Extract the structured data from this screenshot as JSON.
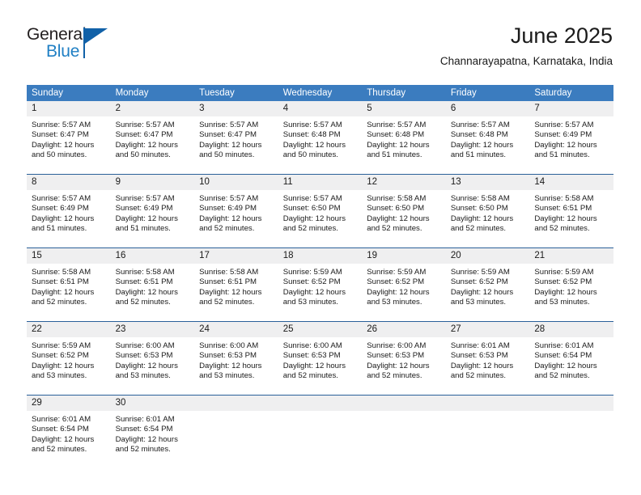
{
  "brand": {
    "name_part1": "General",
    "name_part2": "Blue",
    "logo_icon": "blue-triangle-flag-icon",
    "accent_color": "#1161a8",
    "blue_text_color": "#1f7fc4"
  },
  "header": {
    "title": "June 2025",
    "subtitle": "Channarayapatna, Karnataka, India"
  },
  "calendar": {
    "header_bg_color": "#3b7cbf",
    "daynum_bg_color": "#efeff0",
    "row_separator_color": "#2a6099",
    "weekdays": [
      "Sunday",
      "Monday",
      "Tuesday",
      "Wednesday",
      "Thursday",
      "Friday",
      "Saturday"
    ],
    "weeks": [
      [
        {
          "day": "1",
          "sunrise": "Sunrise: 5:57 AM",
          "sunset": "Sunset: 6:47 PM",
          "daylight": "Daylight: 12 hours and 50 minutes."
        },
        {
          "day": "2",
          "sunrise": "Sunrise: 5:57 AM",
          "sunset": "Sunset: 6:47 PM",
          "daylight": "Daylight: 12 hours and 50 minutes."
        },
        {
          "day": "3",
          "sunrise": "Sunrise: 5:57 AM",
          "sunset": "Sunset: 6:47 PM",
          "daylight": "Daylight: 12 hours and 50 minutes."
        },
        {
          "day": "4",
          "sunrise": "Sunrise: 5:57 AM",
          "sunset": "Sunset: 6:48 PM",
          "daylight": "Daylight: 12 hours and 50 minutes."
        },
        {
          "day": "5",
          "sunrise": "Sunrise: 5:57 AM",
          "sunset": "Sunset: 6:48 PM",
          "daylight": "Daylight: 12 hours and 51 minutes."
        },
        {
          "day": "6",
          "sunrise": "Sunrise: 5:57 AM",
          "sunset": "Sunset: 6:48 PM",
          "daylight": "Daylight: 12 hours and 51 minutes."
        },
        {
          "day": "7",
          "sunrise": "Sunrise: 5:57 AM",
          "sunset": "Sunset: 6:49 PM",
          "daylight": "Daylight: 12 hours and 51 minutes."
        }
      ],
      [
        {
          "day": "8",
          "sunrise": "Sunrise: 5:57 AM",
          "sunset": "Sunset: 6:49 PM",
          "daylight": "Daylight: 12 hours and 51 minutes."
        },
        {
          "day": "9",
          "sunrise": "Sunrise: 5:57 AM",
          "sunset": "Sunset: 6:49 PM",
          "daylight": "Daylight: 12 hours and 51 minutes."
        },
        {
          "day": "10",
          "sunrise": "Sunrise: 5:57 AM",
          "sunset": "Sunset: 6:49 PM",
          "daylight": "Daylight: 12 hours and 52 minutes."
        },
        {
          "day": "11",
          "sunrise": "Sunrise: 5:57 AM",
          "sunset": "Sunset: 6:50 PM",
          "daylight": "Daylight: 12 hours and 52 minutes."
        },
        {
          "day": "12",
          "sunrise": "Sunrise: 5:58 AM",
          "sunset": "Sunset: 6:50 PM",
          "daylight": "Daylight: 12 hours and 52 minutes."
        },
        {
          "day": "13",
          "sunrise": "Sunrise: 5:58 AM",
          "sunset": "Sunset: 6:50 PM",
          "daylight": "Daylight: 12 hours and 52 minutes."
        },
        {
          "day": "14",
          "sunrise": "Sunrise: 5:58 AM",
          "sunset": "Sunset: 6:51 PM",
          "daylight": "Daylight: 12 hours and 52 minutes."
        }
      ],
      [
        {
          "day": "15",
          "sunrise": "Sunrise: 5:58 AM",
          "sunset": "Sunset: 6:51 PM",
          "daylight": "Daylight: 12 hours and 52 minutes."
        },
        {
          "day": "16",
          "sunrise": "Sunrise: 5:58 AM",
          "sunset": "Sunset: 6:51 PM",
          "daylight": "Daylight: 12 hours and 52 minutes."
        },
        {
          "day": "17",
          "sunrise": "Sunrise: 5:58 AM",
          "sunset": "Sunset: 6:51 PM",
          "daylight": "Daylight: 12 hours and 52 minutes."
        },
        {
          "day": "18",
          "sunrise": "Sunrise: 5:59 AM",
          "sunset": "Sunset: 6:52 PM",
          "daylight": "Daylight: 12 hours and 53 minutes."
        },
        {
          "day": "19",
          "sunrise": "Sunrise: 5:59 AM",
          "sunset": "Sunset: 6:52 PM",
          "daylight": "Daylight: 12 hours and 53 minutes."
        },
        {
          "day": "20",
          "sunrise": "Sunrise: 5:59 AM",
          "sunset": "Sunset: 6:52 PM",
          "daylight": "Daylight: 12 hours and 53 minutes."
        },
        {
          "day": "21",
          "sunrise": "Sunrise: 5:59 AM",
          "sunset": "Sunset: 6:52 PM",
          "daylight": "Daylight: 12 hours and 53 minutes."
        }
      ],
      [
        {
          "day": "22",
          "sunrise": "Sunrise: 5:59 AM",
          "sunset": "Sunset: 6:52 PM",
          "daylight": "Daylight: 12 hours and 53 minutes."
        },
        {
          "day": "23",
          "sunrise": "Sunrise: 6:00 AM",
          "sunset": "Sunset: 6:53 PM",
          "daylight": "Daylight: 12 hours and 53 minutes."
        },
        {
          "day": "24",
          "sunrise": "Sunrise: 6:00 AM",
          "sunset": "Sunset: 6:53 PM",
          "daylight": "Daylight: 12 hours and 53 minutes."
        },
        {
          "day": "25",
          "sunrise": "Sunrise: 6:00 AM",
          "sunset": "Sunset: 6:53 PM",
          "daylight": "Daylight: 12 hours and 52 minutes."
        },
        {
          "day": "26",
          "sunrise": "Sunrise: 6:00 AM",
          "sunset": "Sunset: 6:53 PM",
          "daylight": "Daylight: 12 hours and 52 minutes."
        },
        {
          "day": "27",
          "sunrise": "Sunrise: 6:01 AM",
          "sunset": "Sunset: 6:53 PM",
          "daylight": "Daylight: 12 hours and 52 minutes."
        },
        {
          "day": "28",
          "sunrise": "Sunrise: 6:01 AM",
          "sunset": "Sunset: 6:54 PM",
          "daylight": "Daylight: 12 hours and 52 minutes."
        }
      ],
      [
        {
          "day": "29",
          "sunrise": "Sunrise: 6:01 AM",
          "sunset": "Sunset: 6:54 PM",
          "daylight": "Daylight: 12 hours and 52 minutes."
        },
        {
          "day": "30",
          "sunrise": "Sunrise: 6:01 AM",
          "sunset": "Sunset: 6:54 PM",
          "daylight": "Daylight: 12 hours and 52 minutes."
        },
        {
          "day": "",
          "sunrise": "",
          "sunset": "",
          "daylight": ""
        },
        {
          "day": "",
          "sunrise": "",
          "sunset": "",
          "daylight": ""
        },
        {
          "day": "",
          "sunrise": "",
          "sunset": "",
          "daylight": ""
        },
        {
          "day": "",
          "sunrise": "",
          "sunset": "",
          "daylight": ""
        },
        {
          "day": "",
          "sunrise": "",
          "sunset": "",
          "daylight": ""
        }
      ]
    ]
  }
}
